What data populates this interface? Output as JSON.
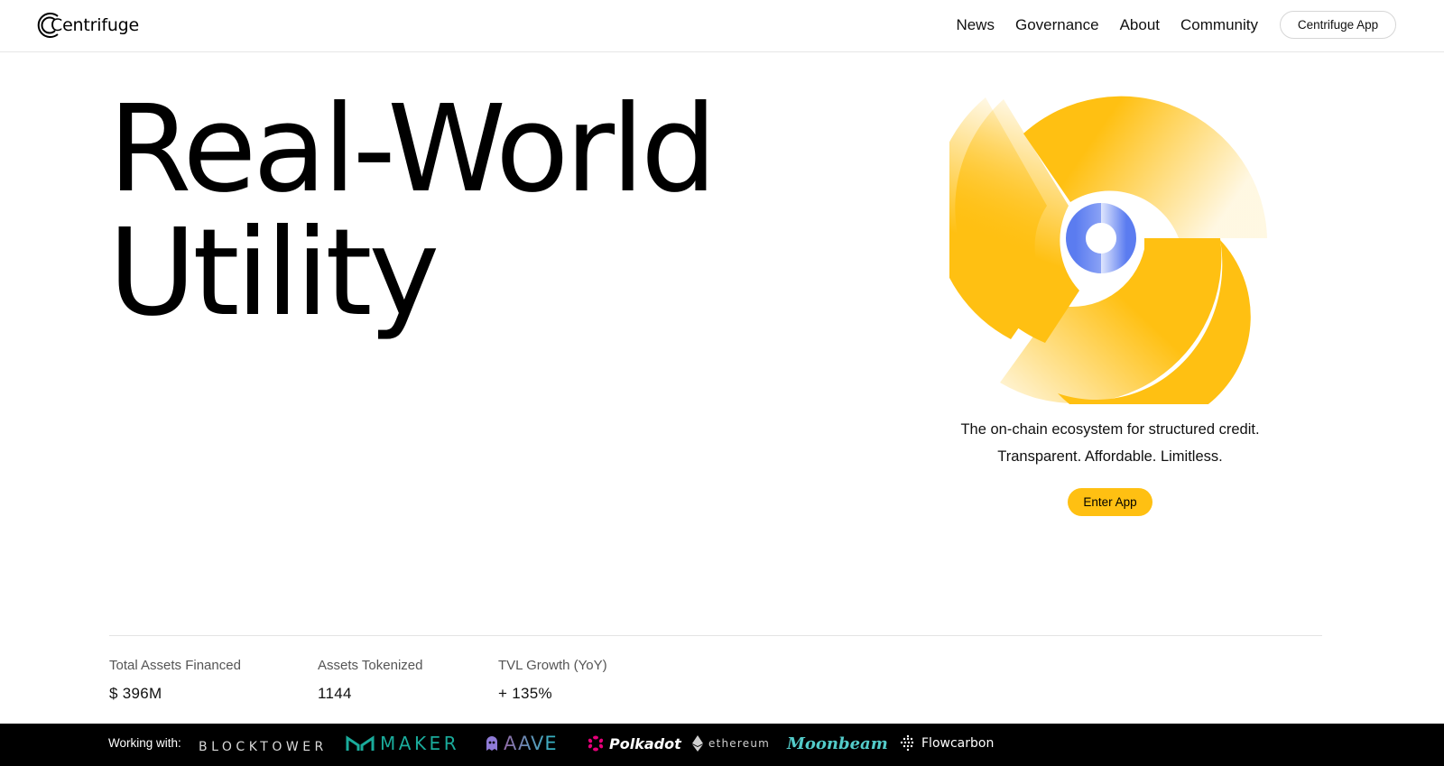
{
  "header": {
    "logo_text": "Centrifuge",
    "nav": [
      {
        "label": "News"
      },
      {
        "label": "Governance"
      },
      {
        "label": "About"
      },
      {
        "label": "Community"
      }
    ],
    "app_button": "Centrifuge App"
  },
  "hero": {
    "title_line1": "Real-World",
    "title_line2": "Utility",
    "tagline1": "The on-chain ecosystem for structured credit.",
    "tagline2": "Transparent. Affordable. Limitless.",
    "cta": "Enter App",
    "accent_color": "#ffc012",
    "center_color": "#5b7cf0"
  },
  "stats": [
    {
      "label": "Total Assets Financed",
      "value": "$ 396M"
    },
    {
      "label": "Assets Tokenized",
      "value": "1144"
    },
    {
      "label": "TVL Growth (YoY)",
      "value": "+ 135%"
    }
  ],
  "partners": {
    "label": "Working with:",
    "logos": [
      {
        "name": "BLOCKTOWER",
        "icon": "blocktower-logo"
      },
      {
        "name": "MAKER",
        "icon": "maker-logo"
      },
      {
        "name": "AAVE",
        "icon": "aave-logo"
      },
      {
        "name": "Polkadot",
        "icon": "polkadot-logo"
      },
      {
        "name": "ethereum",
        "icon": "ethereum-logo"
      },
      {
        "name": "Moonbeam",
        "icon": "moonbeam-logo"
      },
      {
        "name": "Flowcarbon",
        "icon": "flowcarbon-logo"
      }
    ]
  }
}
